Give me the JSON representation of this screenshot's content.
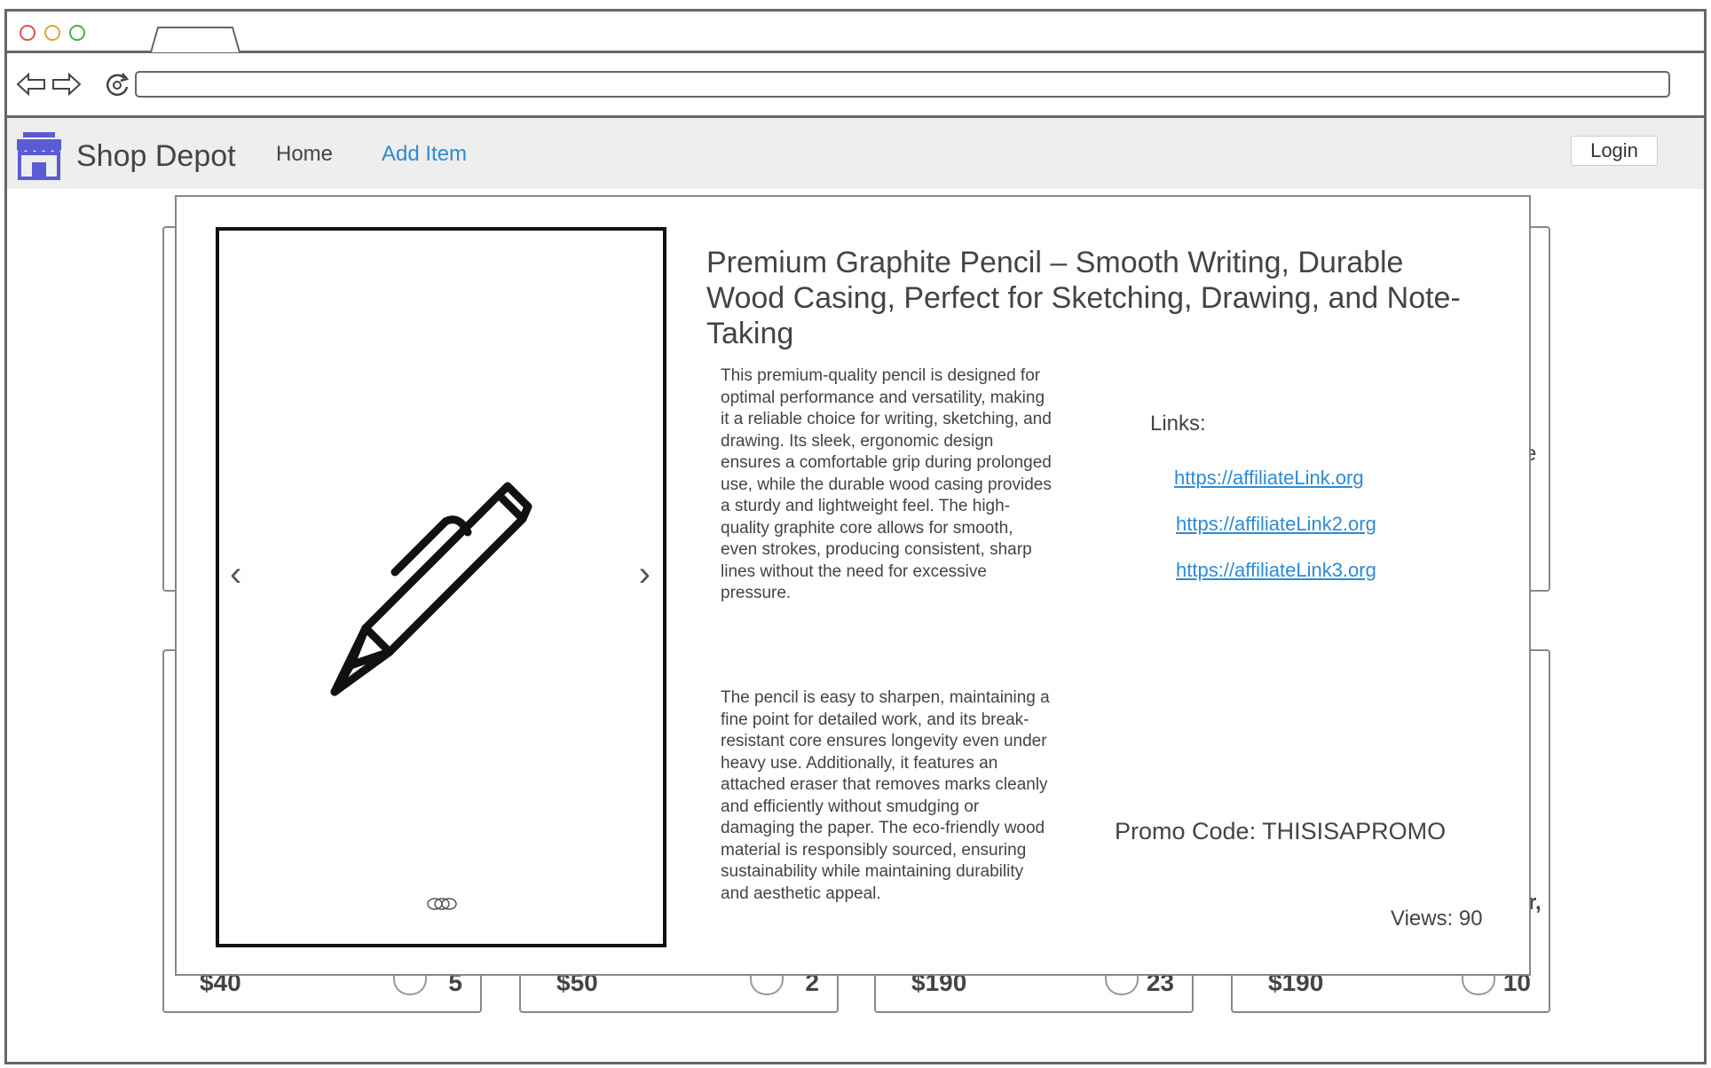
{
  "app": {
    "brand": "Shop Depot",
    "nav": {
      "home": "Home",
      "add_item": "Add Item"
    },
    "login": "Login"
  },
  "background_cards": [
    {
      "price": "$40",
      "likes": "5"
    },
    {
      "price": "$50",
      "likes": "2"
    },
    {
      "price": "$190",
      "likes": "23"
    },
    {
      "price": "$190",
      "likes": "10"
    }
  ],
  "modal": {
    "title": "Premium Graphite Pencil – Smooth Writing, Durable Wood Casing, Perfect for Sketching, Drawing, and Note-Taking",
    "description": [
      "This premium-quality pencil is designed for optimal performance and versatility, making it a reliable choice for writing, sketching, and drawing. Its sleek, ergonomic design ensures a comfortable grip during prolonged use, while the durable wood casing provides a sturdy and lightweight feel. The high-quality graphite core allows for smooth, even strokes, producing consistent, sharp lines without the need for excessive pressure.",
      "The pencil is easy to sharpen, maintaining a fine point for detailed work, and its break-resistant core ensures longevity even under heavy use. Additionally, it features an attached eraser that removes marks cleanly and efficiently without smudging or damaging the paper. The eco-friendly wood material is responsibly sourced, ensuring sustainability while maintaining durability and aesthetic appeal."
    ],
    "links_label": "Links:",
    "links": [
      "https://affiliateLink.org",
      "https://affiliateLink2.org",
      "https://affiliateLink3.org"
    ],
    "promo": "Promo Code: THISISAPROMO",
    "views": "Views: 90",
    "carousel": {
      "image_icon": "pen-icon",
      "prev_icon": "chevron-left-icon",
      "next_icon": "chevron-right-icon"
    }
  },
  "colors": {
    "link": "#2d8bd3",
    "nav_bg": "#eeeeee",
    "logo": "#5b5bd6"
  }
}
